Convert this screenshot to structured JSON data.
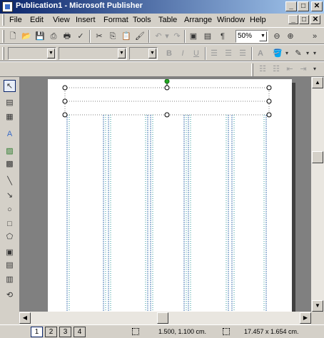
{
  "window": {
    "title": "Publication1 - Microsoft Publisher"
  },
  "menu": [
    "File",
    "Edit",
    "View",
    "Insert",
    "Format",
    "Tools",
    "Table",
    "Arrange",
    "Window",
    "Help"
  ],
  "standard_toolbar": {
    "zoom": "50%"
  },
  "status": {
    "pages": [
      "1",
      "2",
      "3",
      "4"
    ],
    "position": "1.500, 1.100 cm.",
    "size": "17.457 x 1.654 cm."
  }
}
